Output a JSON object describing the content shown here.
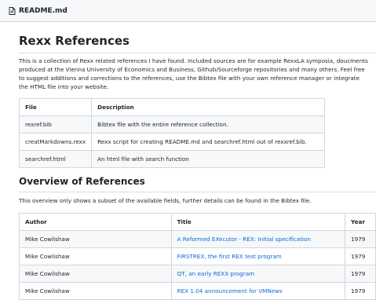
{
  "filebar": {
    "filename": "README.md"
  },
  "article": {
    "title": "Rexx References",
    "intro": "This is a collection of Rexx related references I have found. Included sources are for example RexxLA symposia, doucments produced at the Vienna University of Economics and Business, Github/Sourceforge repositories and many others. Feel free to suggest additions and corrections to the references, use the Bibtex file with your own reference manager or integrate the HTML file into your website.",
    "files_table": {
      "headers": [
        "File",
        "Description"
      ],
      "rows": [
        {
          "file": "rexref.bib",
          "desc": "Bibtex file with the entire reference collection."
        },
        {
          "file": "creatMarkdowns.rexx",
          "desc": "Rexx script for creating README.md and searchref.html out of rexxref.bib."
        },
        {
          "file": "searchref.html",
          "desc": "An html file with search function"
        }
      ]
    },
    "overview_title": "Overview of References",
    "overview_intro": "This overview only shows a subset of the available fields, further details can be found in the Bibtex file.",
    "refs_table": {
      "headers": [
        "Author",
        "Title",
        "Year"
      ],
      "rows": [
        {
          "author": "Mike Cowlishaw",
          "title": "A Reformed EXecutor - REX: Initial specification",
          "year": "1979"
        },
        {
          "author": "Mike Cowlishaw",
          "title": "FIRSTREX, the first REX test program",
          "year": "1979"
        },
        {
          "author": "Mike Cowlishaw",
          "title": "QT, an early REXX program",
          "year": "1979"
        },
        {
          "author": "Mike Cowlishaw",
          "title": "REX 1.04 announcement for VMNews",
          "year": "1979"
        }
      ]
    }
  },
  "colors": {
    "link": "#0969da",
    "border": "#d0d7de",
    "header_bg": "#f6f8fa"
  }
}
